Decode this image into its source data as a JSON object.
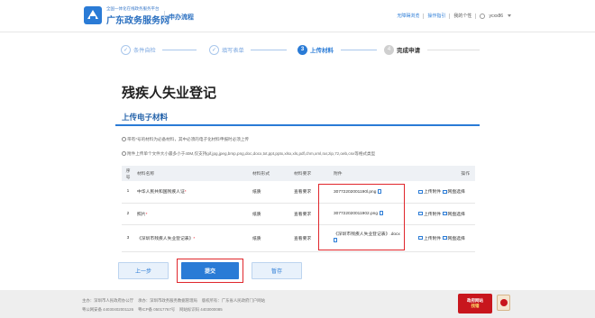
{
  "header": {
    "brand_small": "全国一体化在线政务服务平台",
    "brand_big": "广东政务服务网",
    "sub_title": "申办流程",
    "links": [
      "无障碍浏览",
      "操作指引",
      "我的个性",
      "ycxx86"
    ]
  },
  "steps": [
    {
      "num": "1",
      "label": "条件自检",
      "state": "done"
    },
    {
      "num": "2",
      "label": "填写表单",
      "state": "done"
    },
    {
      "num": "3",
      "label": "上传材料",
      "state": "active"
    },
    {
      "num": "4",
      "label": "完成申请",
      "state": "todo"
    }
  ],
  "page_title": "残疾人失业登记",
  "section_title": "上传电子材料",
  "notes": [
    "带有*号的材料为必备材料，其中必须的电子化材料申报时必须上传",
    "附件上传单个文件大小最多小于40M,仅支持gif,jpg,jpeg,bmp,png,doc,docx,txt,ppt,pptx,xlsx,xls,pdf,chm,xml,rar,zip,7z,oeb,csv等格式类型"
  ],
  "table": {
    "headers": [
      "序号",
      "材料名称",
      "材料形式",
      "材料要求",
      "附件",
      "操作"
    ],
    "rows": [
      {
        "no": "1",
        "name": "中华人民共和国残疾人证",
        "required": "*",
        "form": "纸质",
        "req_link": "查看要求",
        "file": "30772202001190l.png",
        "ops": [
          "上传附件",
          "网盘选择"
        ]
      },
      {
        "no": "2",
        "name": "照片",
        "required": "*",
        "form": "纸质",
        "req_link": "查看要求",
        "file": "307722020011902.png",
        "ops": [
          "上传附件",
          "网盘选择"
        ]
      },
      {
        "no": "3",
        "name": "《深圳市残疾人失业登记表》",
        "required": "*",
        "form": "纸质",
        "req_link": "查看要求",
        "file": "《深圳市残疾人失业登记表》.docx",
        "ops": [
          "上传附件",
          "网盘选择"
        ]
      }
    ]
  },
  "buttons": {
    "prev": "上一步",
    "submit": "提交",
    "save": "暂存"
  },
  "footer": {
    "line1_a": "主办：深圳市人民政府办公厅",
    "line1_b": "承办：深圳市政务服务数据管理局",
    "line1_c": "版权所有：广东省人民政府门户网站",
    "line2_a": "粤公网安备 44030402001126",
    "line2_b": "粤ICP备 05017767号",
    "line2_c": "网站标识码 4403000085",
    "badge_top": "政府网站",
    "badge_bottom": "找错"
  }
}
